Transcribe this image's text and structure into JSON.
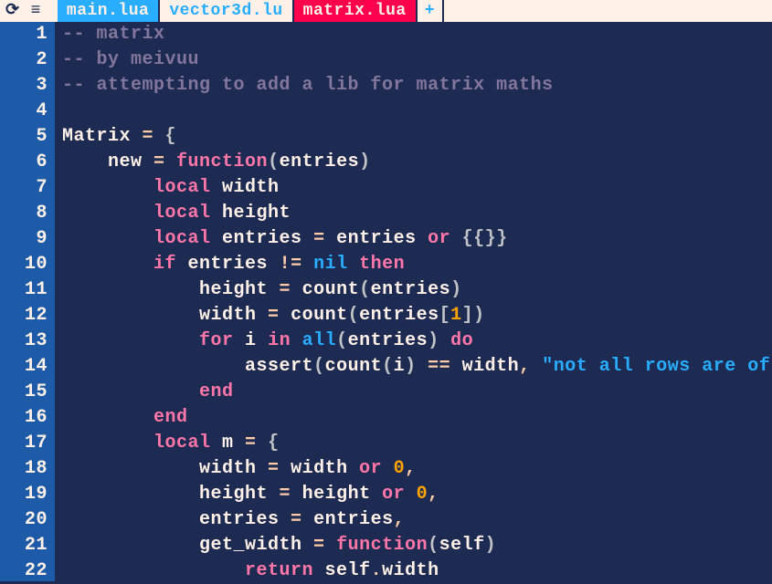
{
  "topbar": {
    "icon_refresh": "⟳",
    "icon_menu": "≡"
  },
  "tabs": [
    {
      "label": "main.lua",
      "state": "active"
    },
    {
      "label": "vector3d.lu",
      "state": "inactive"
    },
    {
      "label": "matrix.lua",
      "state": "current"
    }
  ],
  "tab_plus": "+",
  "gutter": [
    "1",
    "2",
    "3",
    "4",
    "5",
    "6",
    "7",
    "8",
    "9",
    "10",
    "11",
    "12",
    "13",
    "14",
    "15",
    "16",
    "17",
    "18",
    "19",
    "20",
    "21",
    "22"
  ],
  "code": [
    [
      {
        "c": "comment",
        "t": "-- matrix"
      }
    ],
    [
      {
        "c": "comment",
        "t": "-- by meivuu"
      }
    ],
    [
      {
        "c": "comment",
        "t": "-- attempting to add a lib for matrix maths"
      }
    ],
    [],
    [
      {
        "c": "default",
        "t": "Matrix "
      },
      {
        "c": "op",
        "t": "="
      },
      {
        "c": "default",
        "t": " "
      },
      {
        "c": "paren",
        "t": "{"
      }
    ],
    [
      {
        "c": "default",
        "t": "    new "
      },
      {
        "c": "op",
        "t": "="
      },
      {
        "c": "default",
        "t": " "
      },
      {
        "c": "keyword",
        "t": "function"
      },
      {
        "c": "paren",
        "t": "("
      },
      {
        "c": "default",
        "t": "entries"
      },
      {
        "c": "paren",
        "t": ")"
      }
    ],
    [
      {
        "c": "default",
        "t": "        "
      },
      {
        "c": "keyword",
        "t": "local"
      },
      {
        "c": "default",
        "t": " width"
      }
    ],
    [
      {
        "c": "default",
        "t": "        "
      },
      {
        "c": "keyword",
        "t": "local"
      },
      {
        "c": "default",
        "t": " height"
      }
    ],
    [
      {
        "c": "default",
        "t": "        "
      },
      {
        "c": "keyword",
        "t": "local"
      },
      {
        "c": "default",
        "t": " entries "
      },
      {
        "c": "op",
        "t": "="
      },
      {
        "c": "default",
        "t": " entries "
      },
      {
        "c": "keyword",
        "t": "or"
      },
      {
        "c": "default",
        "t": " "
      },
      {
        "c": "paren",
        "t": "{{}}"
      }
    ],
    [
      {
        "c": "default",
        "t": "        "
      },
      {
        "c": "keyword",
        "t": "if"
      },
      {
        "c": "default",
        "t": " entries "
      },
      {
        "c": "op",
        "t": "!="
      },
      {
        "c": "default",
        "t": " "
      },
      {
        "c": "func",
        "t": "nil"
      },
      {
        "c": "default",
        "t": " "
      },
      {
        "c": "keyword",
        "t": "then"
      }
    ],
    [
      {
        "c": "default",
        "t": "            height "
      },
      {
        "c": "op",
        "t": "="
      },
      {
        "c": "default",
        "t": " count"
      },
      {
        "c": "paren",
        "t": "("
      },
      {
        "c": "default",
        "t": "entries"
      },
      {
        "c": "paren",
        "t": ")"
      }
    ],
    [
      {
        "c": "default",
        "t": "            width "
      },
      {
        "c": "op",
        "t": "="
      },
      {
        "c": "default",
        "t": " count"
      },
      {
        "c": "paren",
        "t": "("
      },
      {
        "c": "default",
        "t": "entries"
      },
      {
        "c": "paren",
        "t": "["
      },
      {
        "c": "number",
        "t": "1"
      },
      {
        "c": "paren",
        "t": "])"
      }
    ],
    [
      {
        "c": "default",
        "t": "            "
      },
      {
        "c": "keyword",
        "t": "for"
      },
      {
        "c": "default",
        "t": " i "
      },
      {
        "c": "keyword",
        "t": "in"
      },
      {
        "c": "default",
        "t": " "
      },
      {
        "c": "func",
        "t": "all"
      },
      {
        "c": "paren",
        "t": "("
      },
      {
        "c": "default",
        "t": "entries"
      },
      {
        "c": "paren",
        "t": ")"
      },
      {
        "c": "default",
        "t": " "
      },
      {
        "c": "keyword",
        "t": "do"
      }
    ],
    [
      {
        "c": "default",
        "t": "                assert"
      },
      {
        "c": "paren",
        "t": "("
      },
      {
        "c": "default",
        "t": "count"
      },
      {
        "c": "paren",
        "t": "("
      },
      {
        "c": "default",
        "t": "i"
      },
      {
        "c": "paren",
        "t": ")"
      },
      {
        "c": "default",
        "t": " "
      },
      {
        "c": "op",
        "t": "=="
      },
      {
        "c": "default",
        "t": " width"
      },
      {
        "c": "op",
        "t": ","
      },
      {
        "c": "default",
        "t": " "
      },
      {
        "c": "string",
        "t": "\"not all rows are of equ"
      }
    ],
    [
      {
        "c": "default",
        "t": "            "
      },
      {
        "c": "keyword",
        "t": "end"
      }
    ],
    [
      {
        "c": "default",
        "t": "        "
      },
      {
        "c": "keyword",
        "t": "end"
      }
    ],
    [
      {
        "c": "default",
        "t": "        "
      },
      {
        "c": "keyword",
        "t": "local"
      },
      {
        "c": "default",
        "t": " m "
      },
      {
        "c": "op",
        "t": "="
      },
      {
        "c": "default",
        "t": " "
      },
      {
        "c": "paren",
        "t": "{"
      }
    ],
    [
      {
        "c": "default",
        "t": "            width "
      },
      {
        "c": "op",
        "t": "="
      },
      {
        "c": "default",
        "t": " width "
      },
      {
        "c": "keyword",
        "t": "or"
      },
      {
        "c": "default",
        "t": " "
      },
      {
        "c": "number",
        "t": "0"
      },
      {
        "c": "op",
        "t": ","
      }
    ],
    [
      {
        "c": "default",
        "t": "            height "
      },
      {
        "c": "op",
        "t": "="
      },
      {
        "c": "default",
        "t": " height "
      },
      {
        "c": "keyword",
        "t": "or"
      },
      {
        "c": "default",
        "t": " "
      },
      {
        "c": "number",
        "t": "0"
      },
      {
        "c": "op",
        "t": ","
      }
    ],
    [
      {
        "c": "default",
        "t": "            entries "
      },
      {
        "c": "op",
        "t": "="
      },
      {
        "c": "default",
        "t": " entries"
      },
      {
        "c": "op",
        "t": ","
      }
    ],
    [
      {
        "c": "default",
        "t": "            get_width "
      },
      {
        "c": "op",
        "t": "="
      },
      {
        "c": "default",
        "t": " "
      },
      {
        "c": "keyword",
        "t": "function"
      },
      {
        "c": "paren",
        "t": "("
      },
      {
        "c": "default",
        "t": "self"
      },
      {
        "c": "paren",
        "t": ")"
      }
    ],
    [
      {
        "c": "default",
        "t": "                "
      },
      {
        "c": "keyword",
        "t": "return"
      },
      {
        "c": "default",
        "t": " self"
      },
      {
        "c": "op",
        "t": "."
      },
      {
        "c": "default",
        "t": "width"
      }
    ]
  ]
}
